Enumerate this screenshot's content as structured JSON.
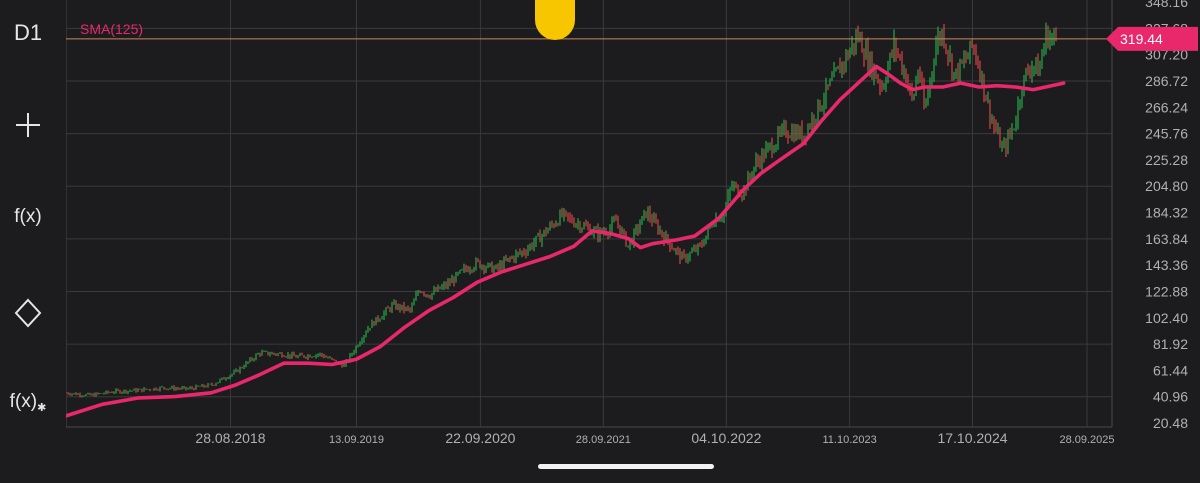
{
  "toolbar": {
    "timeframe": "D1",
    "add_label": "+",
    "indicator_label": "f(x)",
    "drawing_icon": "diamond-icon",
    "indicator_settings_label": "f(x)"
  },
  "colors": {
    "background": "#1c1c1e",
    "grid": "#3a3a3c",
    "up_candle": "#27a84a",
    "down_candle": "#d64545",
    "sma": "#e8286b",
    "price_line": "#c98a5a",
    "price_badge": "#e8286b",
    "axis_text": "#b0b0b0"
  },
  "chart_data": {
    "type": "line",
    "instrument_timeframe": "D1",
    "indicator_label": "SMA(125)",
    "current_price_label": "319.44",
    "current_price": 319.44,
    "y_tick_labels": [
      "348.16",
      "327.68",
      "307.20",
      "286.72",
      "266.24",
      "245.76",
      "225.28",
      "204.80",
      "184.32",
      "163.84",
      "143.36",
      "122.88",
      "102.40",
      "81.92",
      "61.44",
      "40.96",
      "20.48"
    ],
    "x_tick_labels": [
      "28.08.2018",
      "13.09.2019",
      "22.09.2020",
      "28.09.2021",
      "04.10.2022",
      "11.10.2023",
      "17.10.2024",
      "28.09.2025"
    ],
    "ylim": [
      20.48,
      348.16
    ],
    "xlim": [
      2017.3,
      2025.95
    ],
    "series": [
      {
        "name": "price",
        "x": [
          2017.3,
          2017.5,
          2017.7,
          2017.9,
          2018.1,
          2018.3,
          2018.5,
          2018.7,
          2018.9,
          2019.1,
          2019.2,
          2019.4,
          2019.6,
          2019.8,
          2020.0,
          2020.15,
          2020.22,
          2020.3,
          2020.45,
          2020.6,
          2020.7,
          2020.85,
          2021.0,
          2021.1,
          2021.25,
          2021.4,
          2021.55,
          2021.7,
          2021.8,
          2021.85,
          2021.95,
          2022.1,
          2022.25,
          2022.4,
          2022.55,
          2022.65,
          2022.75,
          2022.8,
          2022.9,
          2023.0,
          2023.15,
          2023.25,
          2023.4,
          2023.5,
          2023.6,
          2023.75,
          2023.85,
          2023.95,
          2024.05,
          2024.15,
          2024.25,
          2024.3,
          2024.35,
          2024.4,
          2024.5,
          2024.55,
          2024.65,
          2024.75,
          2024.8,
          2024.85,
          2024.95,
          2025.05,
          2025.15,
          2025.2,
          2025.28,
          2025.35,
          2025.4,
          2025.45,
          2025.5
        ],
        "values": [
          44,
          42,
          45,
          46,
          48,
          47,
          50,
          60,
          75,
          74,
          72,
          74,
          65,
          95,
          112,
          108,
          125,
          120,
          128,
          140,
          145,
          140,
          150,
          155,
          168,
          182,
          175,
          168,
          172,
          178,
          158,
          185,
          165,
          148,
          158,
          178,
          185,
          205,
          200,
          222,
          238,
          248,
          245,
          262,
          280,
          305,
          322,
          300,
          282,
          315,
          290,
          270,
          298,
          262,
          318,
          325,
          290,
          305,
          315,
          298,
          258,
          232,
          255,
          282,
          300,
          295,
          322,
          320,
          318
        ]
      },
      {
        "name": "SMA(125)",
        "x": [
          2017.3,
          2017.6,
          2017.9,
          2018.2,
          2018.5,
          2018.7,
          2018.9,
          2019.1,
          2019.3,
          2019.5,
          2019.7,
          2019.9,
          2020.1,
          2020.3,
          2020.5,
          2020.7,
          2020.9,
          2021.1,
          2021.3,
          2021.5,
          2021.65,
          2021.8,
          2021.95,
          2022.05,
          2022.15,
          2022.35,
          2022.5,
          2022.7,
          2022.9,
          2023.05,
          2023.2,
          2023.4,
          2023.55,
          2023.7,
          2023.85,
          2024.0,
          2024.1,
          2024.2,
          2024.3,
          2024.4,
          2024.55,
          2024.7,
          2024.85,
          2025.0,
          2025.15,
          2025.3,
          2025.45,
          2025.55
        ],
        "values": [
          26,
          35,
          40,
          41,
          44,
          50,
          58,
          67,
          67,
          66,
          70,
          80,
          95,
          108,
          118,
          130,
          138,
          144,
          150,
          158,
          170,
          168,
          164,
          157,
          160,
          163,
          166,
          180,
          202,
          215,
          225,
          238,
          256,
          272,
          285,
          298,
          292,
          285,
          280,
          282,
          282,
          285,
          282,
          283,
          282,
          280,
          283,
          285
        ]
      }
    ]
  }
}
